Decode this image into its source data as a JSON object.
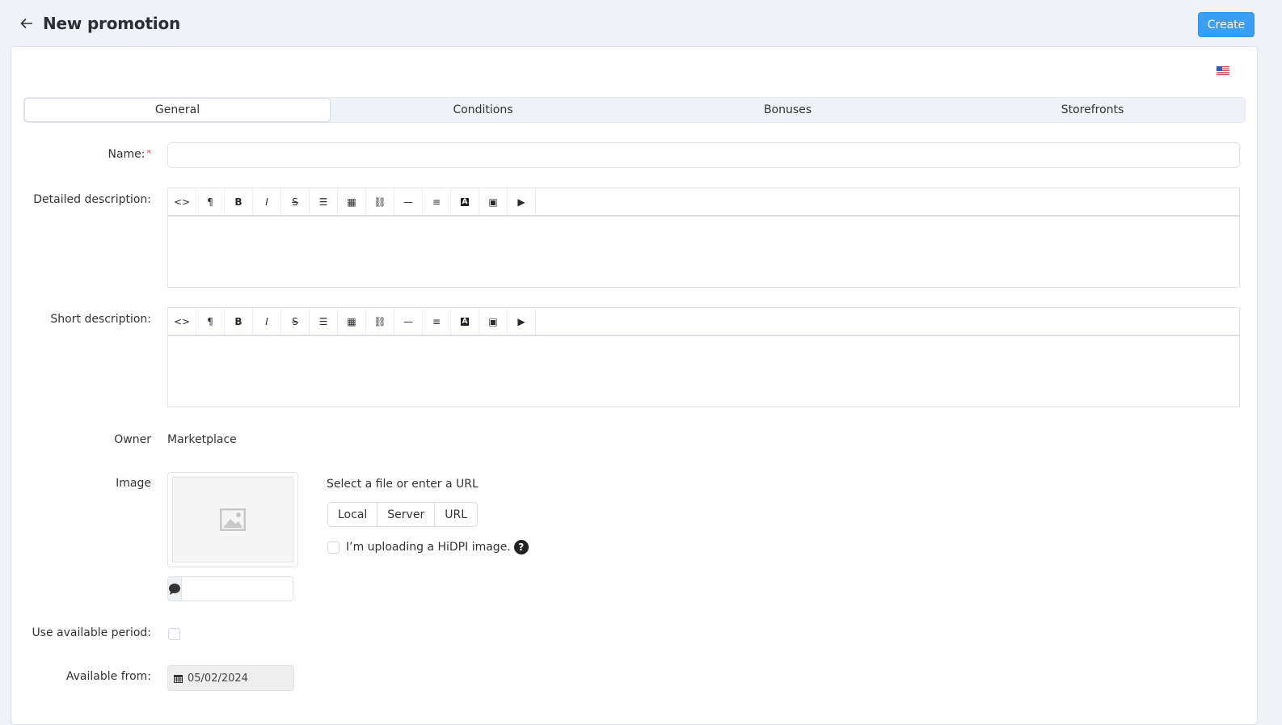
{
  "header": {
    "title": "New promotion",
    "create_label": "Create"
  },
  "language_flag": "us-flag",
  "tabs": [
    {
      "label": "General",
      "active": true
    },
    {
      "label": "Conditions",
      "active": false
    },
    {
      "label": "Bonuses",
      "active": false
    },
    {
      "label": "Storefronts",
      "active": false
    }
  ],
  "form": {
    "name_label": "Name:",
    "name_required": "*",
    "name_value": "",
    "detailed_description_label": "Detailed description:",
    "short_description_label": "Short description:",
    "editor_tools": [
      "code-view",
      "paragraph",
      "bold",
      "italic",
      "strikethrough",
      "bullet-list",
      "table",
      "link",
      "horizontal-rule",
      "align",
      "font-color",
      "image",
      "video"
    ],
    "owner_label": "Owner",
    "owner_value": "Marketplace",
    "image_label": "Image",
    "image_alt_value": "",
    "select_file_text": "Select a file or enter a URL",
    "source_buttons": [
      "Local",
      "Server",
      "URL"
    ],
    "hidpi_label": "I’m uploading a HiDPI image.",
    "hidpi_help": "?",
    "use_period_label": "Use available period:",
    "use_period_checked": false,
    "available_from_label": "Available from:",
    "available_from_value": "05/02/2024"
  }
}
